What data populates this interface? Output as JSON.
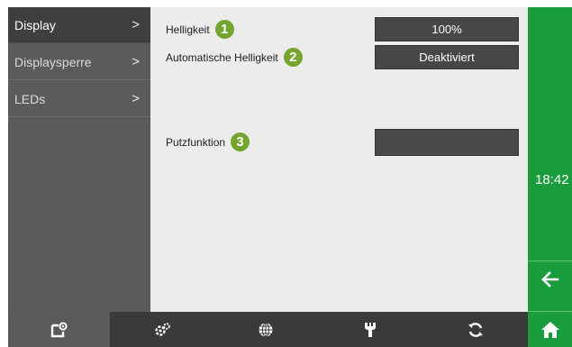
{
  "menu": {
    "items": [
      {
        "label": "Display",
        "active": true
      },
      {
        "label": "Displaysperre",
        "active": false
      },
      {
        "label": "LEDs",
        "active": false
      }
    ],
    "chevron": ">"
  },
  "settings": [
    {
      "label": "Helligkeit",
      "badge": "1",
      "value": "100%"
    },
    {
      "label": "Automatische Helligkeit",
      "badge": "2",
      "value": "Deaktiviert"
    },
    {
      "label": "Putzfunktion",
      "badge": "3",
      "value": ""
    }
  ],
  "sidebar": {
    "time": "18:42",
    "back_icon": "arrow-left-icon",
    "home_icon": "home-icon"
  },
  "bottom_tabs": [
    {
      "icon": "device-settings-icon",
      "active": true
    },
    {
      "icon": "gears-icon",
      "active": false
    },
    {
      "icon": "globe-icon",
      "active": false
    },
    {
      "icon": "wrench-icon",
      "active": false
    },
    {
      "icon": "refresh-icon",
      "active": false
    }
  ],
  "colors": {
    "accent_green": "#1a9b3c",
    "badge_green": "#74a52e",
    "menu_bg": "#5b5b5b",
    "content_bg": "#ececec",
    "value_bg": "#474747"
  }
}
